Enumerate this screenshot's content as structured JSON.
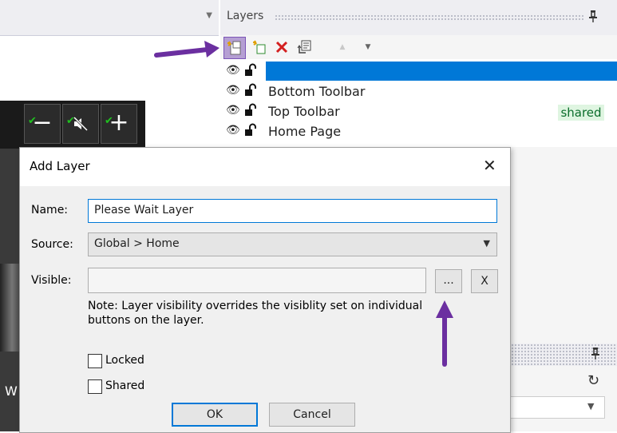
{
  "layers_panel": {
    "title": "Layers",
    "pin_icon": "pin-icon",
    "toolbar_icons": [
      "add-layer-icon",
      "add-sublayer-icon",
      "delete-icon",
      "properties-icon",
      "move-up-icon",
      "move-down-icon"
    ],
    "layers": [
      {
        "name": "",
        "selected": true,
        "badge": ""
      },
      {
        "name": "Bottom Toolbar",
        "selected": false,
        "badge": ""
      },
      {
        "name": "Top Toolbar",
        "selected": false,
        "badge": "shared"
      },
      {
        "name": "Home Page",
        "selected": false,
        "badge": ""
      }
    ]
  },
  "left_strip": {
    "chevron_icon": "chevron-down-icon"
  },
  "preview": {
    "buttons": [
      "−",
      "mute-icon",
      "+"
    ],
    "letter": "W"
  },
  "dialog": {
    "title": "Add Layer",
    "close_glyph": "✕",
    "name_label": "Name:",
    "name_value": "Please Wait Layer",
    "source_label": "Source:",
    "source_value": "Global > Home",
    "visible_label": "Visible:",
    "visible_value": "",
    "ellipsis_label": "...",
    "clear_label": "X",
    "note": "Note: Layer visibility overrides the visiblity set on individual buttons on the layer.",
    "locked_label": "Locked",
    "shared_label": "Shared",
    "locked_checked": false,
    "shared_checked": false,
    "ok_label": "OK",
    "cancel_label": "Cancel"
  },
  "colors": {
    "selection": "#0078d7",
    "annotation_arrow": "#6b2fa0",
    "shared_badge_bg": "#dff5e1",
    "shared_badge_text": "#0a6d2a"
  }
}
